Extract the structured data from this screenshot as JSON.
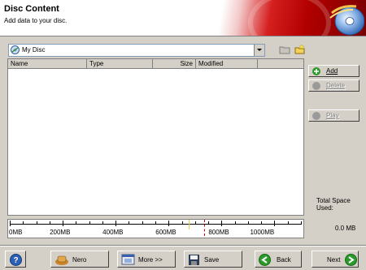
{
  "header": {
    "title": "Disc Content",
    "subtitle": "Add data to your disc."
  },
  "location": {
    "current": "My Disc"
  },
  "columns": [
    "Name",
    "Type",
    "Size",
    "Modified"
  ],
  "files": [],
  "side_buttons": {
    "add": "Add",
    "delete": "Delete",
    "play": "Play"
  },
  "space": {
    "label": "Total Space Used:",
    "value": "0.0 MB"
  },
  "meter": {
    "ticks": [
      "0MB",
      "200MB",
      "400MB",
      "600MB",
      "800MB",
      "1000MB"
    ],
    "used_mb": 0,
    "max_mb": 1100
  },
  "footer": {
    "help": "?",
    "nero": "Nero",
    "more": "More >>",
    "save": "Save",
    "back": "Back",
    "next": "Next"
  },
  "colors": {
    "banner_red": "#c40000",
    "add_green": "#2a9a2a",
    "next_green": "#2a9a2a"
  }
}
